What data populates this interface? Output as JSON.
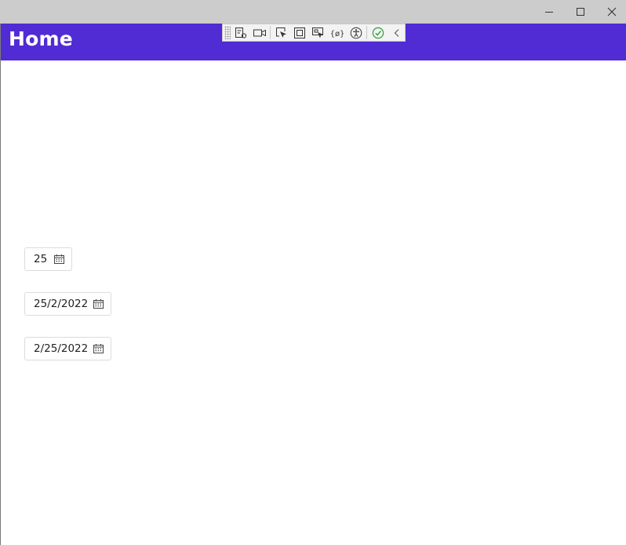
{
  "window": {
    "controls": [
      "minimize-icon",
      "maximize-icon",
      "close-icon"
    ]
  },
  "header": {
    "title": "Home",
    "background": "#512bd4"
  },
  "devtools_toolbar": {
    "icons": [
      "live-visual-tree-icon",
      "record-icon",
      "select-element-icon",
      "display-layout-adorners-icon",
      "track-focus-icon",
      "binding-failures-icon",
      "accessibility-checker-icon",
      "no-issues-check-icon",
      "collapse-toolbar-icon"
    ]
  },
  "date_pickers": [
    {
      "value": "25"
    },
    {
      "value": "25/2/2022"
    },
    {
      "value": "2/25/2022"
    }
  ]
}
